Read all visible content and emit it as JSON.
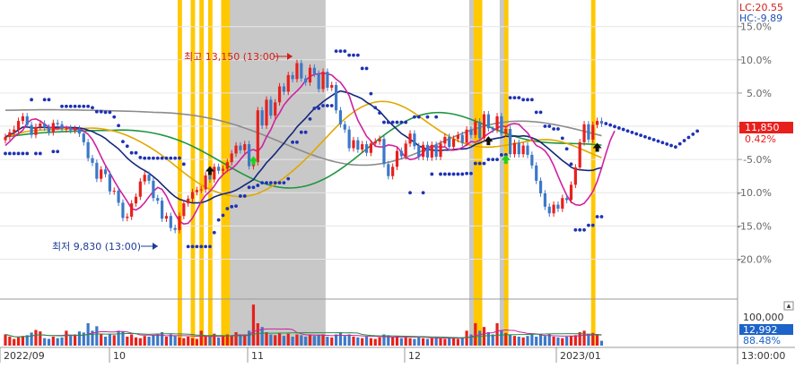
{
  "chart_data": {
    "type": "candlestick",
    "price_axis": {
      "labels": [
        "15.0%",
        "10.0%",
        "5.0%",
        "0.0%",
        "-5.0%",
        "-10.0%",
        "-15.0%",
        "-20.0%"
      ],
      "values": [
        15,
        10,
        5,
        0,
        -5,
        -10,
        -15,
        -20
      ],
      "ylim": [
        -26,
        19
      ]
    },
    "corner": {
      "lc": "LC:20.55",
      "hc": "HC:-9.89"
    },
    "current": {
      "price": "11,850",
      "pct": "0.42%",
      "value": 0.42
    },
    "annotations": {
      "high": {
        "text": "최고 13,150 (13:00)",
        "value": 9.8
      },
      "low": {
        "text": "최저 9,830 (13:00)",
        "value": -15.3
      }
    },
    "x_axis": {
      "labels": [
        "2022/09",
        "10",
        "11",
        "12",
        "2023/01",
        "13:00:00"
      ],
      "count": 140
    },
    "volume_axis": {
      "labels": [
        "100,000",
        "12,992",
        "88.48%"
      ],
      "max": 120000
    },
    "bands": {
      "gray": [
        [
          51,
          74
        ],
        [
          107,
          110
        ],
        [
          114,
          116
        ]
      ],
      "yellow": [
        [
          40,
          41
        ],
        [
          43,
          44
        ],
        [
          45,
          46
        ],
        [
          47,
          48
        ],
        [
          50,
          52
        ],
        [
          108,
          110
        ],
        [
          115,
          116
        ],
        [
          135,
          136
        ]
      ]
    },
    "signals": {
      "black_up": [
        [
          47,
          -6.8
        ],
        [
          111,
          -2.3
        ],
        [
          136,
          -3.3
        ]
      ],
      "green_up": [
        [
          57,
          -5.3
        ],
        [
          115,
          -5.1
        ]
      ]
    },
    "colors": {
      "up": "#e8201c",
      "down": "#3c78c8",
      "ma5": "#d020a0",
      "ma20": "#14287a",
      "ma60": "#e0a800",
      "ma120": "#1e9640",
      "ma240": "#8c8c8c",
      "dots": "#1e32b4",
      "gray_band": "#c8c8c8",
      "yellow_band": "#ffc800"
    },
    "candles": [
      [
        -2.1,
        -1.6,
        -1.1,
        -2.6,
        30000
      ],
      [
        -1.6,
        -0.9,
        -0.4,
        -2.1,
        24000
      ],
      [
        -0.9,
        -0.5,
        0.1,
        -1.4,
        18000
      ],
      [
        -0.5,
        0.8,
        1.3,
        -1.0,
        22000
      ],
      [
        0.8,
        1.5,
        2.0,
        0.3,
        26000
      ],
      [
        1.5,
        0.2,
        2.0,
        -0.3,
        28000
      ],
      [
        0.2,
        -1.3,
        0.7,
        -1.8,
        35000
      ],
      [
        -1.3,
        -0.1,
        0.4,
        -1.8,
        42000
      ],
      [
        -0.1,
        0.4,
        0.9,
        -0.6,
        38000
      ],
      [
        0.4,
        -0.2,
        0.9,
        -0.7,
        20000
      ],
      [
        -0.2,
        -0.9,
        0.3,
        -1.4,
        18000
      ],
      [
        -0.9,
        0.5,
        1.0,
        -1.4,
        24000
      ],
      [
        0.5,
        0.3,
        1.0,
        -0.2,
        20000
      ],
      [
        0.3,
        -0.4,
        0.8,
        -0.9,
        22000
      ],
      [
        -0.4,
        -0.3,
        0.1,
        -0.9,
        40000
      ],
      [
        -0.3,
        -0.6,
        0.2,
        -1.1,
        26000
      ],
      [
        -0.6,
        -0.4,
        0.1,
        -1.1,
        30000
      ],
      [
        -0.4,
        -1.1,
        0.1,
        -1.6,
        38000
      ],
      [
        -1.1,
        -2.4,
        -0.6,
        -2.9,
        35000
      ],
      [
        -2.4,
        -4.8,
        -1.9,
        -5.3,
        60000
      ],
      [
        -4.8,
        -5.5,
        -4.3,
        -6.0,
        40000
      ],
      [
        -5.5,
        -7.9,
        -5.0,
        -8.4,
        52000
      ],
      [
        -7.9,
        -6.5,
        -6.0,
        -8.4,
        30000
      ],
      [
        -6.5,
        -7.2,
        -6.0,
        -7.7,
        24000
      ],
      [
        -7.2,
        -9.8,
        -6.7,
        -10.3,
        30000
      ],
      [
        -9.8,
        -9.7,
        -9.2,
        -10.3,
        28000
      ],
      [
        -9.7,
        -11.5,
        -9.2,
        -12.0,
        40000
      ],
      [
        -11.5,
        -13.8,
        -11.0,
        -14.3,
        38000
      ],
      [
        -13.8,
        -13.6,
        -13.1,
        -14.3,
        24000
      ],
      [
        -13.6,
        -11.6,
        -11.1,
        -14.1,
        30000
      ],
      [
        -11.6,
        -10.6,
        -10.1,
        -12.1,
        22000
      ],
      [
        -10.6,
        -8.3,
        -7.8,
        -11.1,
        20000
      ],
      [
        -8.3,
        -7.3,
        -6.8,
        -8.8,
        26000
      ],
      [
        -7.3,
        -8.2,
        -6.8,
        -8.7,
        24000
      ],
      [
        -8.2,
        -10.8,
        -7.7,
        -11.3,
        28000
      ],
      [
        -10.8,
        -11.2,
        -10.3,
        -11.7,
        30000
      ],
      [
        -11.2,
        -13.9,
        -10.7,
        -14.4,
        36000
      ],
      [
        -13.9,
        -13.5,
        -13.0,
        -14.4,
        24000
      ],
      [
        -13.5,
        -15.3,
        -13.0,
        -15.8,
        30000
      ],
      [
        -15.3,
        -15.6,
        -14.8,
        -16.1,
        26000
      ],
      [
        -15.6,
        -13.5,
        -13.0,
        -16.1,
        22000
      ],
      [
        -13.5,
        -11.6,
        -11.1,
        -14.0,
        20000
      ],
      [
        -11.6,
        -10.9,
        -10.4,
        -12.1,
        24000
      ],
      [
        -10.9,
        -9.9,
        -9.4,
        -11.4,
        20000
      ],
      [
        -9.9,
        -9.6,
        -9.1,
        -10.4,
        18000
      ],
      [
        -9.6,
        -9.5,
        -9.0,
        -10.1,
        40000
      ],
      [
        -9.5,
        -7.4,
        -6.9,
        -10.0,
        26000
      ],
      [
        -7.4,
        -8.0,
        -6.9,
        -8.5,
        24000
      ],
      [
        -8.0,
        -6.1,
        -5.6,
        -8.5,
        32000
      ],
      [
        -6.1,
        -6.7,
        -5.6,
        -7.2,
        22000
      ],
      [
        -6.7,
        -6.4,
        -5.9,
        -7.2,
        26000
      ],
      [
        -6.4,
        -5.4,
        -4.9,
        -6.9,
        30000
      ],
      [
        -5.4,
        -4.1,
        -3.6,
        -5.9,
        28000
      ],
      [
        -4.1,
        -2.9,
        -2.4,
        -4.6,
        36000
      ],
      [
        -2.9,
        -3.6,
        -2.4,
        -4.1,
        26000
      ],
      [
        -3.6,
        -2.7,
        -2.2,
        -4.1,
        30000
      ],
      [
        -2.7,
        -6.0,
        -2.2,
        -6.5,
        40000
      ],
      [
        -6.0,
        -5.4,
        -4.9,
        -6.5,
        110000
      ],
      [
        -5.4,
        2.4,
        2.9,
        -5.9,
        60000
      ],
      [
        2.4,
        0.1,
        2.9,
        -0.4,
        50000
      ],
      [
        0.1,
        4.0,
        4.5,
        -0.4,
        36000
      ],
      [
        4.0,
        1.6,
        4.5,
        1.1,
        30000
      ],
      [
        1.6,
        3.6,
        4.1,
        1.1,
        28000
      ],
      [
        3.6,
        6.0,
        6.5,
        3.1,
        34000
      ],
      [
        6.0,
        5.2,
        6.5,
        4.7,
        26000
      ],
      [
        5.2,
        7.7,
        8.2,
        4.7,
        32000
      ],
      [
        7.7,
        7.1,
        8.2,
        6.6,
        24000
      ],
      [
        7.1,
        9.5,
        10.0,
        6.6,
        30000
      ],
      [
        9.5,
        7.2,
        10.0,
        6.7,
        28000
      ],
      [
        7.2,
        6.6,
        7.7,
        6.1,
        24000
      ],
      [
        6.6,
        8.8,
        9.3,
        6.1,
        30000
      ],
      [
        8.8,
        7.9,
        9.3,
        7.4,
        26000
      ],
      [
        7.9,
        5.6,
        8.4,
        5.1,
        28000
      ],
      [
        5.6,
        8.2,
        8.7,
        5.1,
        30000
      ],
      [
        8.2,
        5.8,
        8.7,
        5.3,
        24000
      ],
      [
        5.8,
        6.2,
        6.7,
        5.3,
        22000
      ],
      [
        6.2,
        2.4,
        6.7,
        1.9,
        30000
      ],
      [
        2.4,
        0.3,
        2.9,
        -0.2,
        34000
      ],
      [
        0.3,
        -0.5,
        0.8,
        -1.0,
        26000
      ],
      [
        -0.5,
        -3.3,
        0.0,
        -3.8,
        30000
      ],
      [
        -3.3,
        -2.1,
        -1.6,
        -3.8,
        24000
      ],
      [
        -2.1,
        -3.5,
        -1.6,
        -4.0,
        22000
      ],
      [
        -3.5,
        -2.7,
        -2.2,
        -4.0,
        20000
      ],
      [
        -2.7,
        -4.0,
        -2.2,
        -4.5,
        24000
      ],
      [
        -4.0,
        -2.6,
        -2.1,
        -4.5,
        20000
      ],
      [
        -2.6,
        -2.3,
        -1.8,
        -3.1,
        18000
      ],
      [
        -2.3,
        -1.9,
        -1.4,
        -2.8,
        22000
      ],
      [
        -1.9,
        -5.7,
        -1.4,
        -6.2,
        30000
      ],
      [
        -5.7,
        -7.5,
        -5.2,
        -8.0,
        28000
      ],
      [
        -7.5,
        -6.1,
        -5.6,
        -8.0,
        24000
      ],
      [
        -6.1,
        -3.7,
        -3.2,
        -6.6,
        26000
      ],
      [
        -3.7,
        -4.5,
        -3.2,
        -5.0,
        20000
      ],
      [
        -4.5,
        -2.6,
        -2.1,
        -5.0,
        22000
      ],
      [
        -2.6,
        -1.1,
        -0.6,
        -3.1,
        20000
      ],
      [
        -1.1,
        -3.0,
        -0.6,
        -3.5,
        18000
      ],
      [
        -3.0,
        -4.6,
        -2.5,
        -5.1,
        22000
      ],
      [
        -4.6,
        -2.8,
        -2.3,
        -5.1,
        20000
      ],
      [
        -2.8,
        -4.7,
        -2.3,
        -5.2,
        18000
      ],
      [
        -4.7,
        -2.8,
        -2.3,
        -5.2,
        20000
      ],
      [
        -2.8,
        -4.6,
        -2.3,
        -5.1,
        22000
      ],
      [
        -4.6,
        -2.6,
        -2.1,
        -5.1,
        20000
      ],
      [
        -2.6,
        -1.6,
        -1.1,
        -3.1,
        18000
      ],
      [
        -1.6,
        -3.1,
        -1.1,
        -3.6,
        22000
      ],
      [
        -3.1,
        -1.9,
        -1.4,
        -3.6,
        20000
      ],
      [
        -1.9,
        -1.3,
        -0.8,
        -2.4,
        18000
      ],
      [
        -1.3,
        -2.5,
        -0.8,
        -3.0,
        22000
      ],
      [
        -2.5,
        -0.5,
        0.0,
        -3.0,
        40000
      ],
      [
        -0.5,
        -1.3,
        0.0,
        -1.8,
        30000
      ],
      [
        -1.3,
        0.7,
        1.2,
        -1.8,
        60000
      ],
      [
        0.7,
        -1.8,
        1.2,
        -2.3,
        40000
      ],
      [
        -1.8,
        1.8,
        2.3,
        -2.3,
        50000
      ],
      [
        1.8,
        -0.3,
        2.3,
        -0.8,
        36000
      ],
      [
        -0.3,
        -0.5,
        0.0,
        -1.0,
        30000
      ],
      [
        -0.5,
        1.5,
        2.0,
        -1.0,
        60000
      ],
      [
        1.5,
        -1.1,
        2.0,
        -1.6,
        40000
      ],
      [
        -1.1,
        -0.4,
        0.1,
        -1.6,
        34000
      ],
      [
        -0.4,
        -4.2,
        0.1,
        -4.7,
        30000
      ],
      [
        -4.2,
        -2.5,
        -2.0,
        -4.7,
        26000
      ],
      [
        -2.5,
        -4.2,
        -2.0,
        -4.7,
        24000
      ],
      [
        -4.2,
        -2.9,
        -2.4,
        -4.7,
        22000
      ],
      [
        -2.9,
        -4.3,
        -2.4,
        -4.8,
        26000
      ],
      [
        -4.3,
        -5.9,
        -3.8,
        -6.4,
        30000
      ],
      [
        -5.9,
        -8.2,
        -5.4,
        -8.7,
        24000
      ],
      [
        -8.2,
        -10.1,
        -7.7,
        -10.6,
        30000
      ],
      [
        -10.1,
        -12.1,
        -9.6,
        -12.6,
        26000
      ],
      [
        -12.1,
        -13.1,
        -11.6,
        -13.6,
        32000
      ],
      [
        -13.1,
        -11.8,
        -11.3,
        -13.6,
        24000
      ],
      [
        -11.8,
        -12.4,
        -11.3,
        -12.9,
        22000
      ],
      [
        -12.4,
        -10.8,
        -10.3,
        -12.9,
        20000
      ],
      [
        -10.8,
        -11.1,
        -10.3,
        -11.6,
        24000
      ],
      [
        -11.1,
        -8.8,
        -8.3,
        -11.6,
        26000
      ],
      [
        -8.8,
        -6.2,
        -5.7,
        -9.3,
        28000
      ],
      [
        -6.2,
        -2.4,
        -1.9,
        -6.7,
        36000
      ],
      [
        -2.4,
        0.3,
        0.8,
        -2.9,
        40000
      ],
      [
        0.3,
        -2.0,
        0.8,
        -2.5,
        30000
      ],
      [
        -2.0,
        0.2,
        0.7,
        -2.5,
        34000
      ],
      [
        0.2,
        0.8,
        1.3,
        -0.3,
        30000
      ],
      [
        0.8,
        0.4,
        1.3,
        -0.1,
        12992
      ]
    ],
    "ma5": [
      -2.9,
      -2.3,
      -1.6,
      -1.1,
      -0.6,
      0.5,
      1.0,
      1.1,
      0.8,
      0.3,
      -0.1,
      -0.3,
      -0.4,
      -0.1,
      -0.2,
      -0.3,
      -0.5,
      -0.4,
      -0.7,
      -1.2,
      -2.0,
      -3.2,
      -4.6,
      -5.9,
      -7.0,
      -8.2,
      -9.3,
      -10.3,
      -11.3,
      -12.4,
      -12.6,
      -12.2,
      -11.5,
      -10.6,
      -9.8,
      -9.2,
      -9.5,
      -10.5,
      -11.9,
      -13.2,
      -14.3,
      -14.7,
      -14.6,
      -13.8,
      -12.6,
      -11.3,
      -10.4,
      -9.8,
      -9.0,
      -8.0,
      -7.3,
      -6.7,
      -6.4,
      -5.8,
      -5.0,
      -4.2,
      -3.7,
      -3.5,
      -3.8,
      -3.0,
      -1.6,
      -0.5,
      1.0,
      2.0,
      3.2,
      4.0,
      4.7,
      5.3,
      6.0,
      6.9,
      7.5,
      7.8,
      7.9,
      8.0,
      7.9,
      7.7,
      7.1,
      6.6,
      5.7,
      4.6,
      2.6,
      0.9,
      -0.3,
      -1.5,
      -2.2,
      -3.0,
      -3.1,
      -3.1,
      -2.8,
      -2.9,
      -3.1,
      -3.9,
      -4.7,
      -5.0,
      -4.9,
      -4.6,
      -4.0,
      -3.2,
      -3.0,
      -3.1,
      -3.1,
      -3.1,
      -3.6,
      -3.6,
      -3.5,
      -3.2,
      -2.8,
      -2.3,
      -2.4,
      -2.1,
      -1.6,
      -1.1,
      -0.7,
      -0.3,
      0.1,
      -0.1,
      0.3,
      0.4,
      0.3,
      -0.4,
      -1.0,
      -2.0,
      -2.9,
      -3.2,
      -3.7,
      -4.6,
      -5.9,
      -7.5,
      -9.0,
      -10.4,
      -11.4,
      -11.8,
      -11.9,
      -11.6,
      -10.8,
      -9.8,
      -8.3,
      -6.3,
      -4.1,
      -2.1,
      -0.7
    ]
  }
}
